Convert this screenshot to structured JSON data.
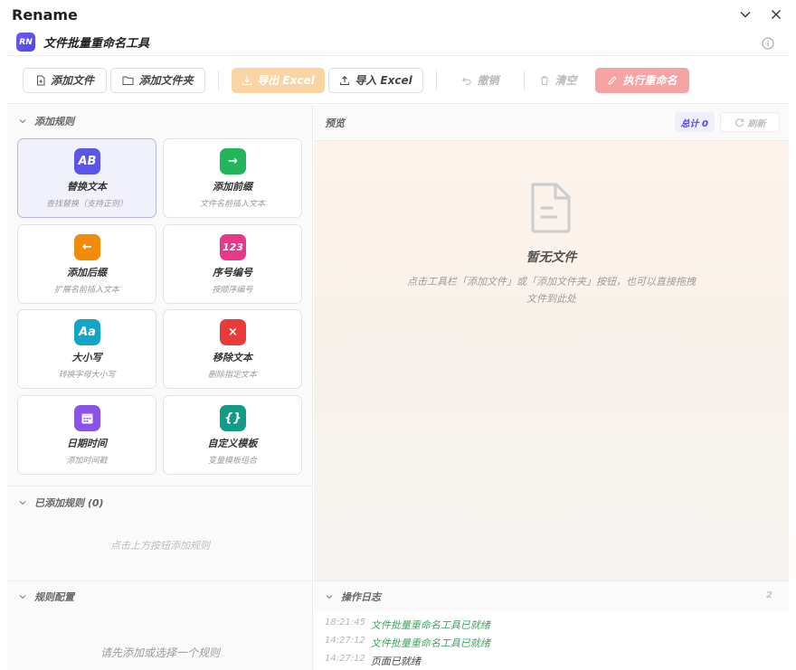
{
  "window": {
    "title": "Rename"
  },
  "app": {
    "logo_text": "RN",
    "title": "文件批量重命名工具"
  },
  "toolbar": {
    "add_file": "添加文件",
    "add_folder": "添加文件夹",
    "export_excel": "导出 Excel",
    "import_excel": "导入 Excel",
    "undo": "撤销",
    "clear": "清空",
    "execute": "执行重命名"
  },
  "rules_section": {
    "title": "添加规则"
  },
  "rules": [
    {
      "icon": "AB",
      "title": "替换文本",
      "desc": "查找替换（支持正则）",
      "color": "#5b55e8"
    },
    {
      "icon": "→",
      "title": "添加前缀",
      "desc": "文件名前插入文本",
      "color": "#22b55a"
    },
    {
      "icon": "←",
      "title": "添加后缀",
      "desc": "扩展名前插入文本",
      "color": "#f08c0a"
    },
    {
      "icon": "123",
      "title": "序号编号",
      "desc": "按顺序编号",
      "color": "#e8388a"
    },
    {
      "icon": "Aa",
      "title": "大小写",
      "desc": "转换字母大小写",
      "color": "#12a5c6"
    },
    {
      "icon": "×",
      "title": "移除文本",
      "desc": "删除指定文本",
      "color": "#ea3b3b"
    },
    {
      "icon": "calendar",
      "title": "日期时间",
      "desc": "添加时间戳",
      "color": "#8b52e6"
    },
    {
      "icon": "{}",
      "title": "自定义模板",
      "desc": "变量模板组合",
      "color": "#129b86"
    }
  ],
  "added_rules": {
    "title": "已添加规则 (0)",
    "hint": "点击上方按钮添加规则"
  },
  "rule_config": {
    "title": "规则配置",
    "hint": "请先添加或选择一个规则"
  },
  "preview": {
    "title": "预览",
    "total_label": "总计 0",
    "refresh_label": "刷新",
    "empty_title": "暂无文件",
    "empty_desc": "点击工具栏「添加文件」或「添加文件夹」按钮，也可以直接拖拽文件到此处"
  },
  "log": {
    "title": "操作日志",
    "count": "2",
    "entries": [
      {
        "time": "18:21:45",
        "msg": "文件批量重命名工具已就绪",
        "kind": "ok"
      },
      {
        "time": "14:27:12",
        "msg": "文件批量重命名工具已就绪",
        "kind": "ok"
      },
      {
        "time": "14:27:12",
        "msg": "页面已就绪",
        "kind": "plain"
      }
    ]
  }
}
